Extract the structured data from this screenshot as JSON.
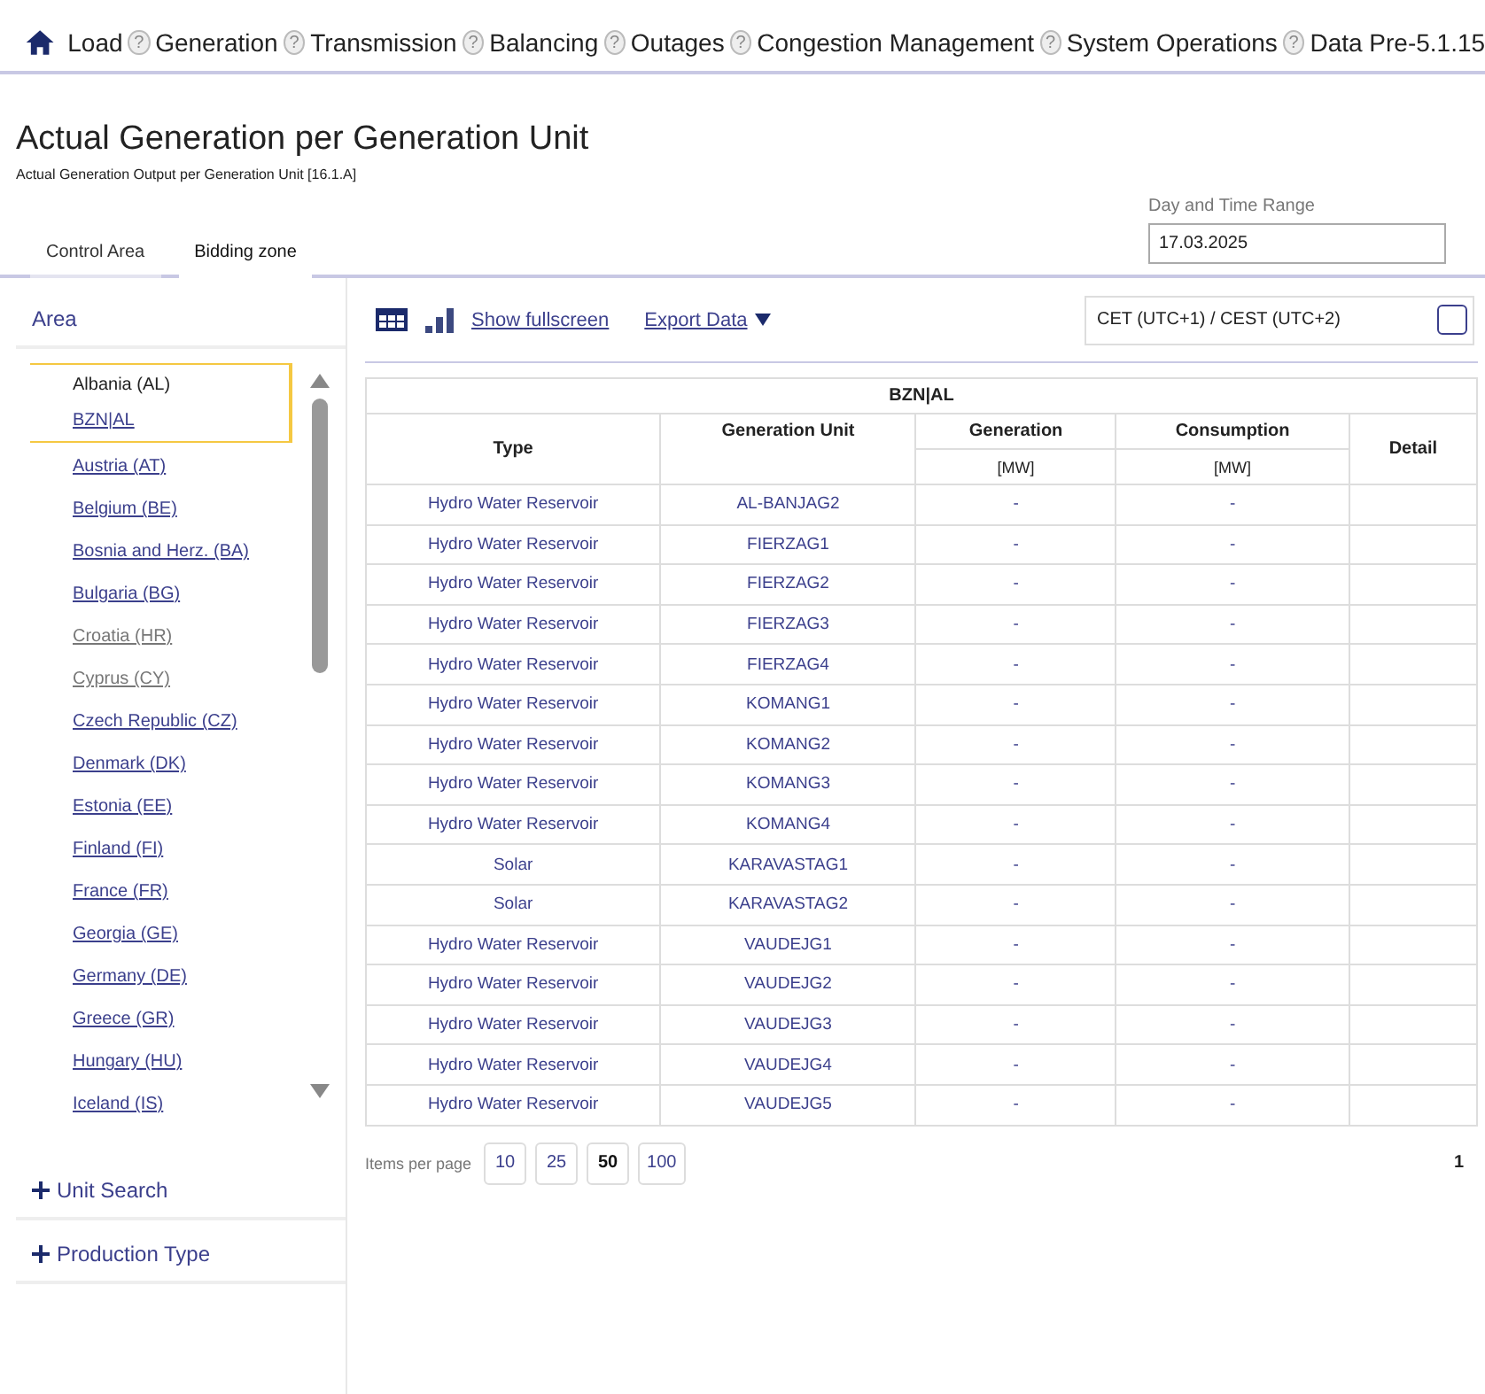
{
  "nav": [
    {
      "label": "Load"
    },
    {
      "label": "Generation"
    },
    {
      "label": "Transmission"
    },
    {
      "label": "Balancing"
    },
    {
      "label": "Outages"
    },
    {
      "label": "Congestion Management"
    },
    {
      "label": "System Operations"
    },
    {
      "label": "Data Pre-5.1.15"
    }
  ],
  "nav_help": "?",
  "title": "Actual Generation per Generation Unit",
  "subtitle": "Actual Generation Output per Generation Unit [16.1.A]",
  "area_tabs": [
    {
      "label": "Control Area",
      "selected": false
    },
    {
      "label": "Bidding zone",
      "selected": true
    }
  ],
  "date_range": {
    "label": "Day and Time Range",
    "value": "17.03.2025"
  },
  "sidebar": {
    "heading": "Area",
    "selected": {
      "name": "Albania (AL)",
      "sub": "BZN|AL"
    },
    "items": [
      {
        "label": "Austria (AT)",
        "disabled": false
      },
      {
        "label": "Belgium (BE)",
        "disabled": false
      },
      {
        "label": "Bosnia and Herz. (BA)",
        "disabled": false
      },
      {
        "label": "Bulgaria (BG)",
        "disabled": false
      },
      {
        "label": "Croatia (HR)",
        "disabled": true
      },
      {
        "label": "Cyprus (CY)",
        "disabled": true
      },
      {
        "label": "Czech Republic (CZ)",
        "disabled": false
      },
      {
        "label": "Denmark (DK)",
        "disabled": false
      },
      {
        "label": "Estonia (EE)",
        "disabled": false
      },
      {
        "label": "Finland (FI)",
        "disabled": false
      },
      {
        "label": "France (FR)",
        "disabled": false
      },
      {
        "label": "Georgia (GE)",
        "disabled": false
      },
      {
        "label": "Germany (DE)",
        "disabled": false
      },
      {
        "label": "Greece (GR)",
        "disabled": false
      },
      {
        "label": "Hungary (HU)",
        "disabled": false
      },
      {
        "label": "Iceland (IS)",
        "disabled": false
      }
    ],
    "sections": [
      {
        "label": "Unit Search",
        "expanded": false
      },
      {
        "label": "Production Type",
        "expanded": false
      }
    ]
  },
  "toolbar": {
    "view": [
      {
        "kind": "table",
        "selected": true
      },
      {
        "kind": "chart",
        "selected": false
      }
    ],
    "fullscreen": "Show fullscreen",
    "export": "Export Data",
    "timezone": "CET (UTC+1) / CEST (UTC+2)",
    "timezone_checked": false
  },
  "table": {
    "group": "BZN|AL",
    "columns": [
      "Type",
      "Generation Unit",
      "Generation",
      "Consumption",
      "Detail"
    ],
    "units": [
      "[MW]",
      "[MW]"
    ],
    "rows": [
      [
        "Hydro Water Reservoir",
        "AL-BANJAG2",
        "-",
        "-"
      ],
      [
        "Hydro Water Reservoir",
        "FIERZAG1",
        "-",
        "-"
      ],
      [
        "Hydro Water Reservoir",
        "FIERZAG2",
        "-",
        "-"
      ],
      [
        "Hydro Water Reservoir",
        "FIERZAG3",
        "-",
        "-"
      ],
      [
        "Hydro Water Reservoir",
        "FIERZAG4",
        "-",
        "-"
      ],
      [
        "Hydro Water Reservoir",
        "KOMANG1",
        "-",
        "-"
      ],
      [
        "Hydro Water Reservoir",
        "KOMANG2",
        "-",
        "-"
      ],
      [
        "Hydro Water Reservoir",
        "KOMANG3",
        "-",
        "-"
      ],
      [
        "Hydro Water Reservoir",
        "KOMANG4",
        "-",
        "-"
      ],
      [
        "Solar",
        "KARAVASTAG1",
        "-",
        "-"
      ],
      [
        "Solar",
        "KARAVASTAG2",
        "-",
        "-"
      ],
      [
        "Hydro Water Reservoir",
        "VAUDEJG1",
        "-",
        "-"
      ],
      [
        "Hydro Water Reservoir",
        "VAUDEJG2",
        "-",
        "-"
      ],
      [
        "Hydro Water Reservoir",
        "VAUDEJG3",
        "-",
        "-"
      ],
      [
        "Hydro Water Reservoir",
        "VAUDEJG4",
        "-",
        "-"
      ],
      [
        "Hydro Water Reservoir",
        "VAUDEJG5",
        "-",
        "-"
      ]
    ]
  },
  "pagination": {
    "label": "Items per page",
    "sizes": [
      {
        "label": "10",
        "selected": false
      },
      {
        "label": "25",
        "selected": false
      },
      {
        "label": "50",
        "selected": true
      },
      {
        "label": "100",
        "selected": false
      }
    ],
    "page": "1"
  }
}
